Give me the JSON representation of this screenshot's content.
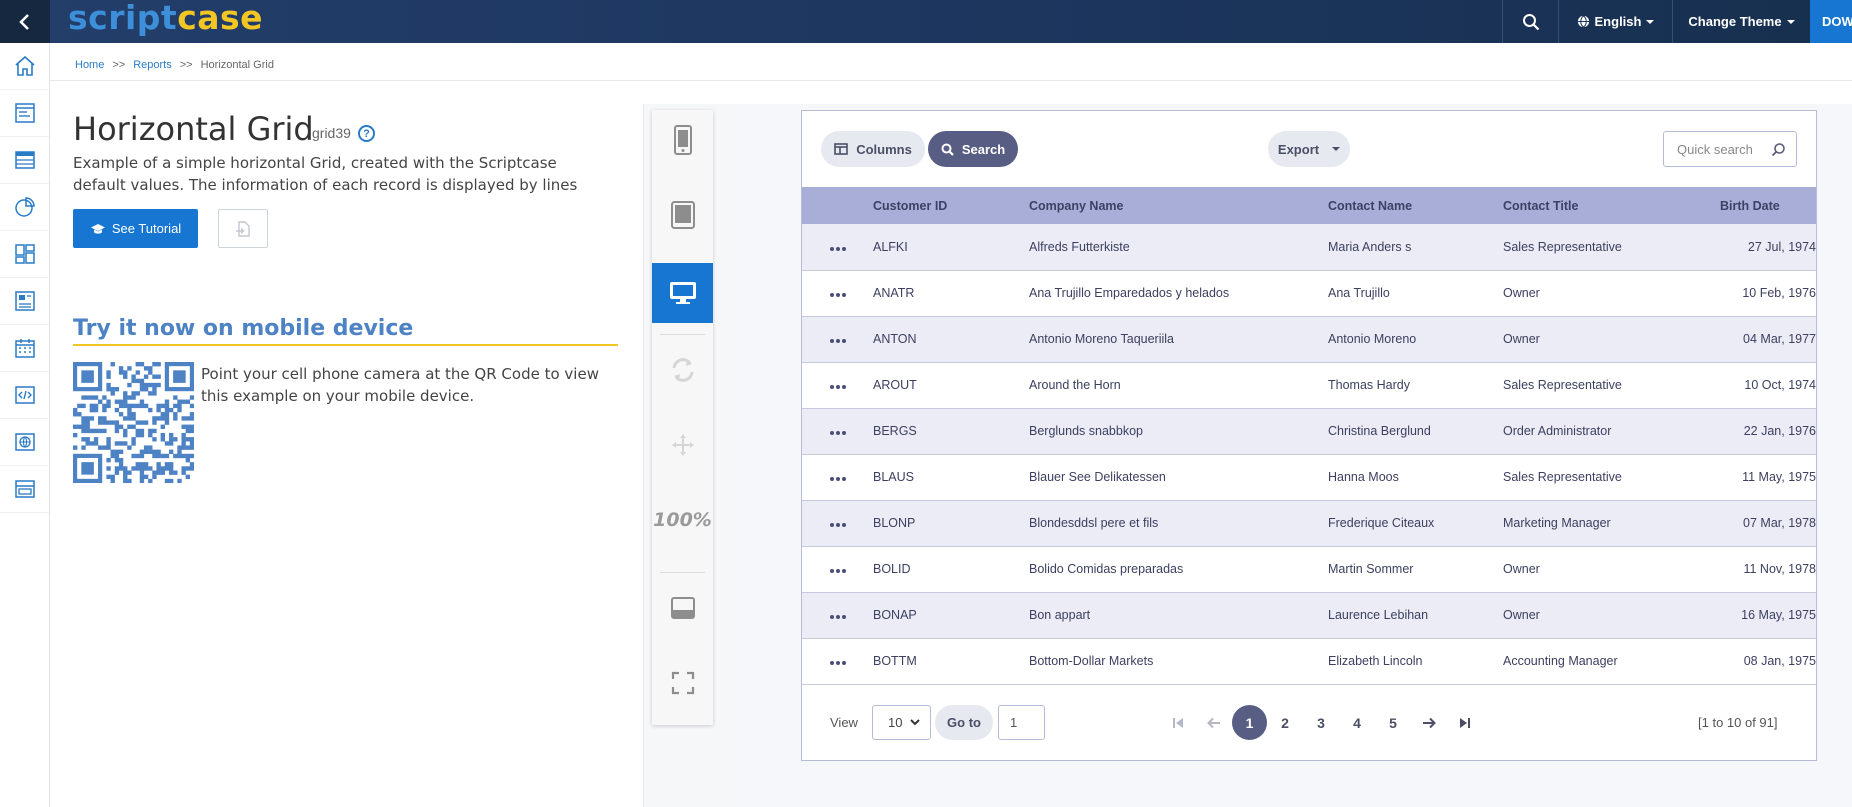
{
  "topbar": {
    "logo_part1": "script",
    "logo_part2": "case",
    "language": "English",
    "theme": "Change Theme",
    "download": "DOW"
  },
  "breadcrumb": {
    "home": "Home",
    "reports": "Reports",
    "current": "Horizontal Grid",
    "separator": ">>"
  },
  "page": {
    "title": "Horizontal Grid",
    "code": "grid39",
    "help": "?",
    "description": "Example of a simple horizontal Grid, created with the Scriptcase default values. The information of each record is displayed by lines",
    "tutorial_button": "See Tutorial",
    "try_title": "Try it now on mobile device",
    "qr_text": "Point your cell phone camera at the QR Code to view this example on your mobile device."
  },
  "toolstrip": {
    "zoom": "100%"
  },
  "grid": {
    "toolbar": {
      "columns": "Columns",
      "search": "Search",
      "export": "Export",
      "quick_search_placeholder": "Quick search"
    },
    "columns": [
      "Customer ID",
      "Company Name",
      "Contact Name",
      "Contact Title",
      "Birth Date"
    ],
    "rows": [
      {
        "id": "ALFKI",
        "company": "Alfreds Futterkiste",
        "contact": "Maria Anders s",
        "title": "Sales Representative",
        "birth": "27 Jul, 1974"
      },
      {
        "id": "ANATR",
        "company": "Ana Trujillo Emparedados y helados",
        "contact": "Ana Trujillo",
        "title": "Owner",
        "birth": "10 Feb, 1976"
      },
      {
        "id": "ANTON",
        "company": "Antonio Moreno Taqueriila",
        "contact": "Antonio Moreno",
        "title": "Owner",
        "birth": "04 Mar, 1977"
      },
      {
        "id": "AROUT",
        "company": "Around the Horn",
        "contact": "Thomas Hardy",
        "title": "Sales Representative",
        "birth": "10 Oct, 1974"
      },
      {
        "id": "BERGS",
        "company": "Berglunds snabbkop",
        "contact": "Christina Berglund",
        "title": "Order Administrator",
        "birth": "22 Jan, 1976"
      },
      {
        "id": "BLAUS",
        "company": "Blauer See Delikatessen",
        "contact": "Hanna Moos",
        "title": "Sales Representative",
        "birth": "11 May, 1975"
      },
      {
        "id": "BLONP",
        "company": "Blondesddsl pere et fils",
        "contact": "Frederique Citeaux",
        "title": "Marketing Manager",
        "birth": "07 Mar, 1978"
      },
      {
        "id": "BOLID",
        "company": "Bolido Comidas preparadas",
        "contact": "Martin Sommer",
        "title": "Owner",
        "birth": "11 Nov, 1978"
      },
      {
        "id": "BONAP",
        "company": "Bon appart",
        "contact": "Laurence Lebihan",
        "title": "Owner",
        "birth": "16 May, 1975"
      },
      {
        "id": "BOTTM",
        "company": "Bottom-Dollar Markets",
        "contact": "Elizabeth Lincoln",
        "title": "Accounting Manager",
        "birth": "08 Jan, 1975"
      }
    ],
    "footer": {
      "view_label": "View",
      "view_value": "10",
      "goto_label": "Go to",
      "goto_value": "1",
      "pages": [
        "1",
        "2",
        "3",
        "4",
        "5"
      ],
      "current_page": "1",
      "info": "[1 to 10 of 91]"
    }
  },
  "colors": {
    "topbar": "#1c355d",
    "accent": "#1676d2",
    "logo_blue": "#3d8fd9",
    "logo_yellow": "#f3c623",
    "grid_header": "#a9aed8",
    "grid_pill_active": "#585d84"
  }
}
